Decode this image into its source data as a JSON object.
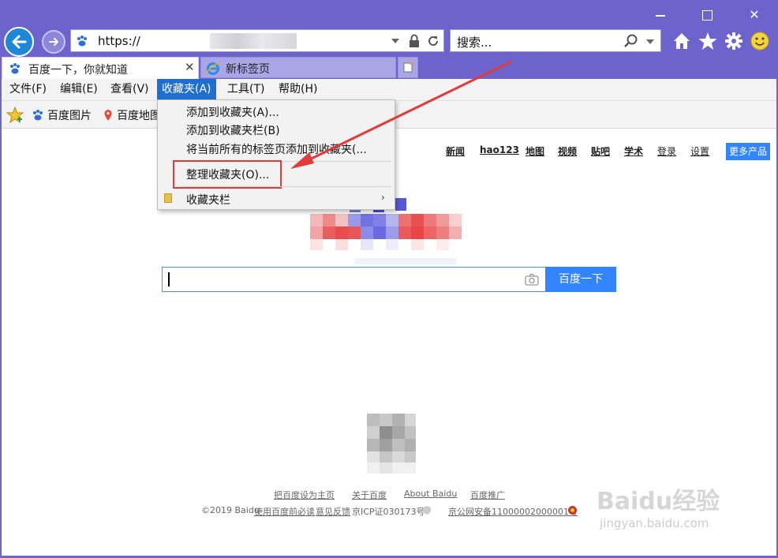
{
  "window": {
    "minimize": "—",
    "maximize": "□",
    "close": "✕"
  },
  "address": {
    "text": "https://"
  },
  "search_top": {
    "placeholder": "搜索..."
  },
  "tabs": [
    {
      "label": "百度一下，你就知道",
      "close": "✕"
    },
    {
      "label": "新标签页"
    }
  ],
  "menubar": [
    {
      "label": "文件(F)"
    },
    {
      "label": "编辑(E)"
    },
    {
      "label": "查看(V)"
    },
    {
      "label": "收藏夹(A)"
    },
    {
      "label": "工具(T)"
    },
    {
      "label": "帮助(H)"
    }
  ],
  "favbar": [
    {
      "label": "百度图片"
    },
    {
      "label": "百度地图"
    }
  ],
  "dropdown": {
    "items": [
      {
        "label": "添加到收藏夹(A)..."
      },
      {
        "label": "添加到收藏夹栏(B)"
      },
      {
        "label": "将当前所有的标签页添加到收藏夹(..."
      },
      {
        "label": "整理收藏夹(O)..."
      },
      {
        "label": "收藏夹栏"
      }
    ],
    "submenu_arrow": "›"
  },
  "page": {
    "nav": [
      "新闻",
      "hao123",
      "地图",
      "视频",
      "贴吧",
      "学术",
      "登录",
      "设置"
    ],
    "more_products": "更多产品",
    "search_button": "百度一下",
    "footer_links": [
      "把百度设为主页",
      "关于百度",
      "About  Baidu",
      "百度推广"
    ],
    "footer_line2": {
      "copyright": "©2019 Baidu",
      "terms": "使用百度前必读",
      "feedback": "意见反馈",
      "icp": "京ICP证030173号",
      "police": "京公网安备11000002000001号"
    }
  },
  "watermark": {
    "main": "Baidu经验",
    "sub": "jingyan.baidu.com"
  },
  "colors": {
    "chrome": "#6c64cc",
    "accent": "#3385ff",
    "menu_highlight": "#1e6fd0",
    "annotation": "#e23a3a"
  }
}
